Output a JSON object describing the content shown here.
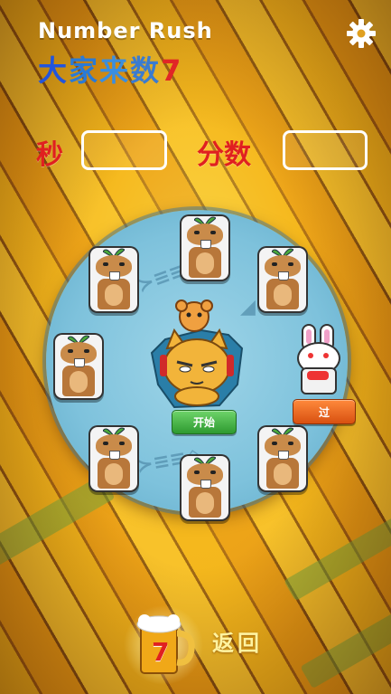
{
  "header": {
    "title": "Number Rush",
    "subtitle_chars": [
      {
        "ch": "大",
        "color": "#2255dd"
      },
      {
        "ch": "家",
        "color": "#2a7ad6"
      },
      {
        "ch": "来",
        "color": "#3a8ee0"
      },
      {
        "ch": "数",
        "color": "#3a7bd0"
      },
      {
        "ch": "7",
        "color": "#e12626"
      }
    ],
    "settings_icon": "gear-icon"
  },
  "stats": {
    "seconds_label": "秒",
    "seconds_value": "",
    "score_label": "分数",
    "score_value": ""
  },
  "board": {
    "animals_count": 8,
    "special": "bunny",
    "center": "cat-with-mouse"
  },
  "buttons": {
    "start_label": "开始",
    "pass_label": "过"
  },
  "footer": {
    "back_label": "返回",
    "mug_number": "7"
  },
  "colors": {
    "accent_red": "#e02020",
    "start_green": "#2e9a30",
    "pass_orange": "#e05a18",
    "board_blue": "#7ec2dc"
  }
}
